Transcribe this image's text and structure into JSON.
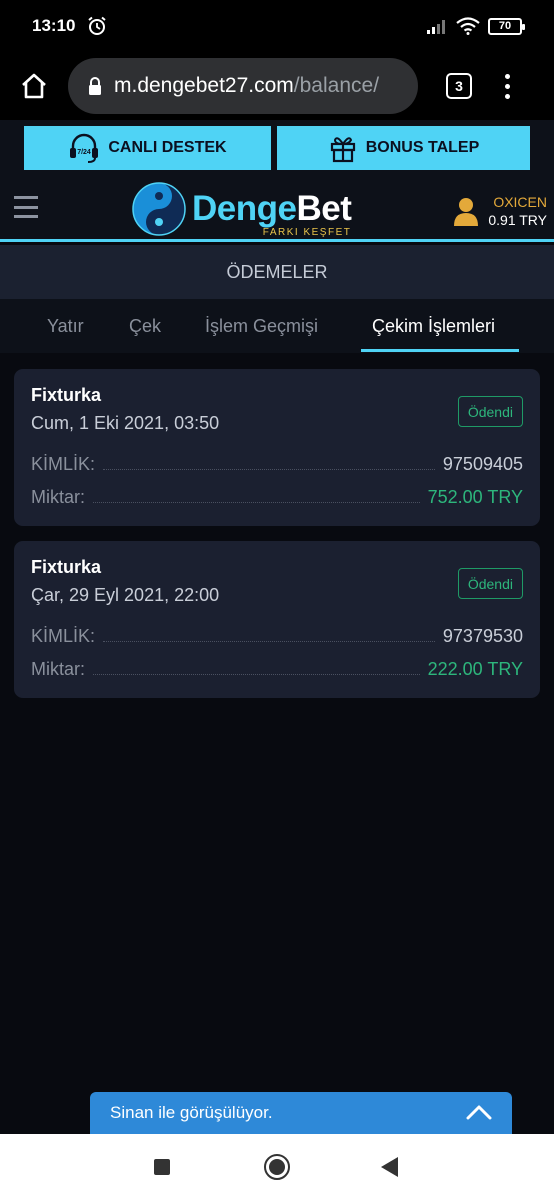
{
  "status_bar": {
    "time": "13:10",
    "battery": "70"
  },
  "browser": {
    "url_host": "m.dengebet27.com",
    "url_path": "/balance/",
    "tab_count": "3"
  },
  "promo": {
    "support_label": "CANLI DESTEK",
    "bonus_label": "BONUS TALEP",
    "support_icon_text": "7/24"
  },
  "header": {
    "logo_part1": "Denge",
    "logo_part2": "Bet",
    "tagline": "FARKI KEŞFET",
    "username": "OXICEN",
    "balance": "0.91 TRY"
  },
  "section_title": "ÖDEMELER",
  "tabs": [
    {
      "label": "Yatır"
    },
    {
      "label": "Çek"
    },
    {
      "label": "İşlem Geçmişi"
    },
    {
      "label": "Çekim İşlemleri"
    }
  ],
  "transactions": [
    {
      "provider": "Fixturka",
      "date": "Cum, 1 Eki 2021, 03:50",
      "status": "Ödendi",
      "id_label": "KİMLİK:",
      "id_value": "97509405",
      "amount_label": "Miktar:",
      "amount_value": "752.00 TRY"
    },
    {
      "provider": "Fixturka",
      "date": "Çar, 29 Eyl 2021, 22:00",
      "status": "Ödendi",
      "id_label": "KİMLİK:",
      "id_value": "97379530",
      "amount_label": "Miktar:",
      "amount_value": "222.00 TRY"
    }
  ],
  "chat": {
    "label": "Sinan ile görüşülüyor."
  },
  "colors": {
    "accent": "#4fd3f5",
    "success": "#2db67c",
    "user_name": "#e3a93a",
    "chat": "#2e89d8"
  }
}
